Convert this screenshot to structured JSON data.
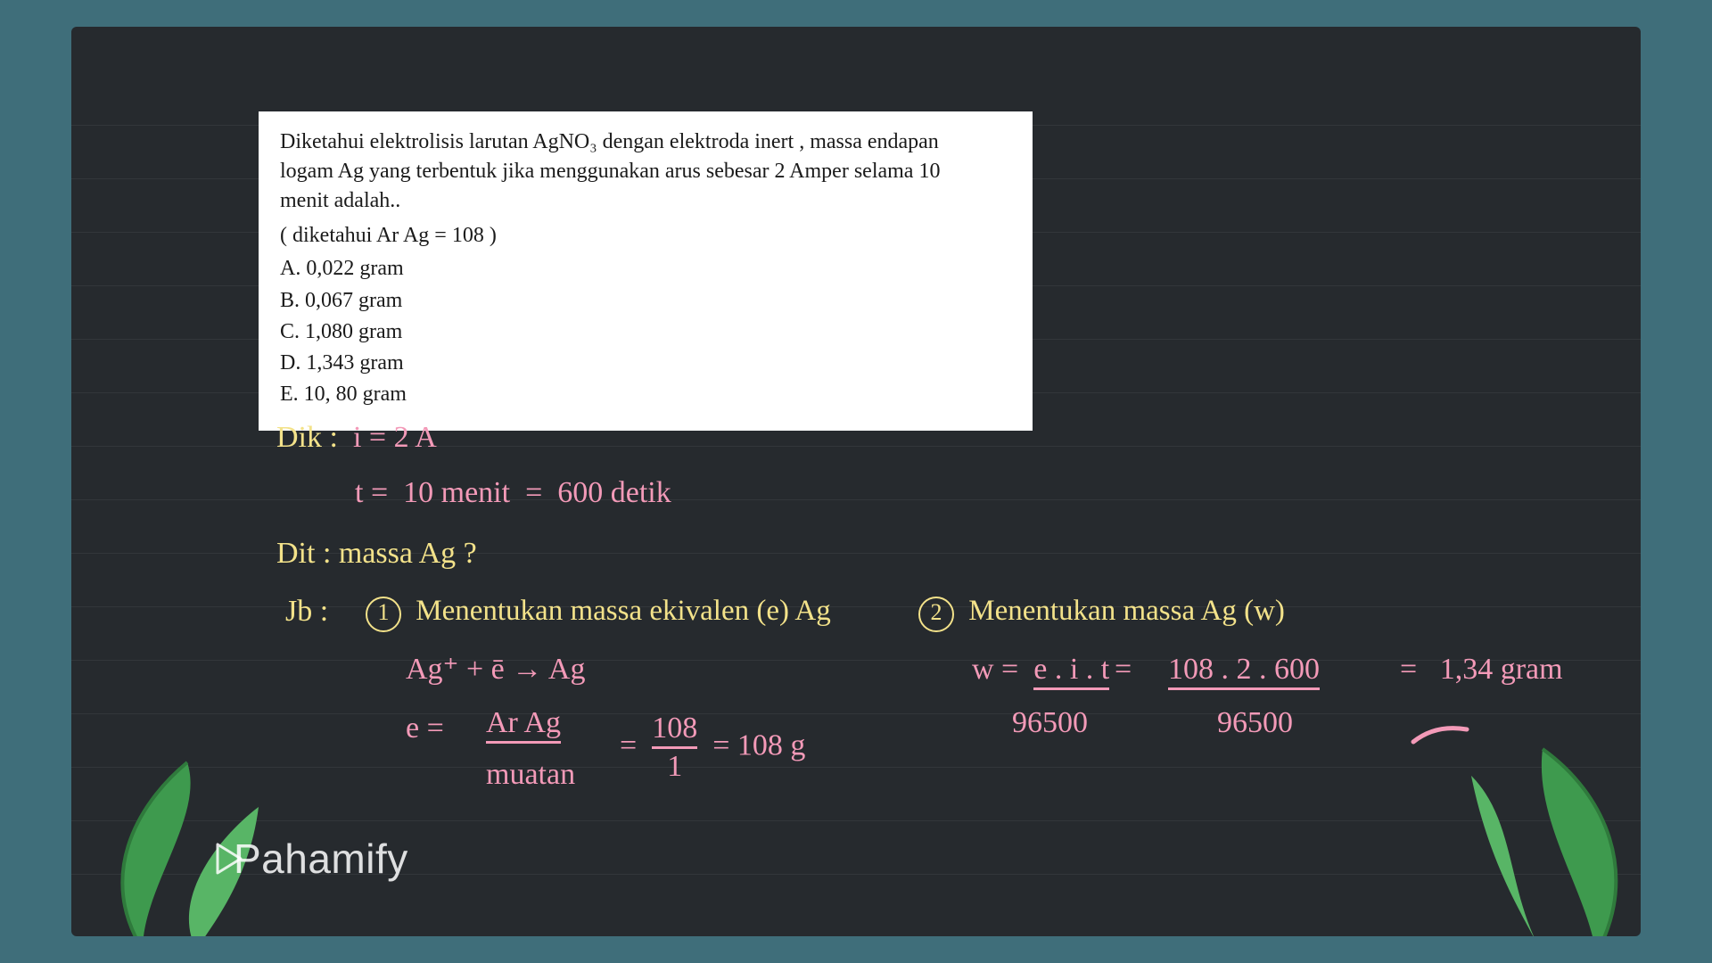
{
  "brand": {
    "name": "Pahamify"
  },
  "question": {
    "prompt_line1": "Diketahui elektrolisis larutan AgNO₃ dengan elektroda inert , massa endapan",
    "prompt_line2": "logam Ag yang terbentuk jika menggunakan arus sebesar  2 Amper selama 10",
    "prompt_line3": "menit adalah..",
    "given": "( diketahui Ar Ag = 108 )",
    "options": [
      "A.  0,022 gram",
      "B.  0,067 gram",
      "C.  1,080 gram",
      "D.  1,343 gram",
      "E.  10, 80 gram"
    ]
  },
  "work": {
    "dik_label": "Dik :",
    "i_expr": "i = 2 A",
    "t_label": "t =",
    "t_val_min": "10 menit",
    "t_eq": "=",
    "t_val_sec": "600 detik",
    "dit": "Dit :  massa Ag ?",
    "jb_label": "Jb :",
    "step1_num": "1",
    "step1_text": "Menentukan massa ekivalen (e) Ag",
    "ag_rxn": "Ag⁺ + ē  →  Ag",
    "e_label": "e =",
    "e_frac_top": "Ar Ag",
    "e_frac_bot": "muatan",
    "e_eq1": "=",
    "e_val_top": "108",
    "e_val_bot": "1",
    "e_eq2": "= 108 g",
    "step2_num": "2",
    "step2_text": "Menentukan massa Ag (w)",
    "w_label": "w =",
    "w_formula": "e . i . t",
    "w_eq1": "=",
    "w_numtop": "108 . 2 . 600",
    "w_den1": "96500",
    "w_den2": "96500",
    "w_eq2": "=",
    "w_result": "1,34 gram"
  }
}
